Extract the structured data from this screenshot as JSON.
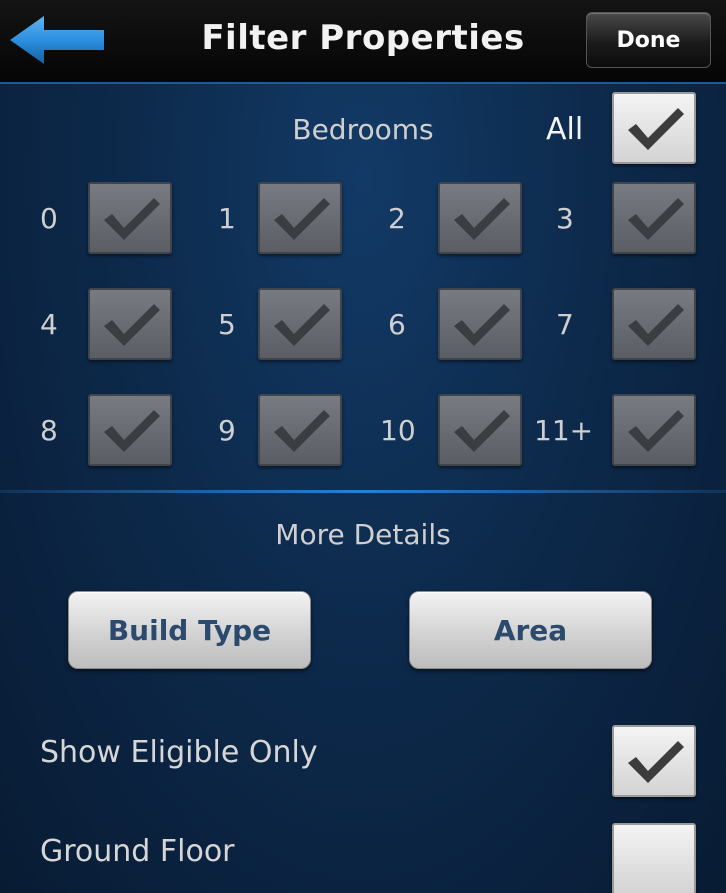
{
  "nav": {
    "title": "Filter Properties",
    "done_label": "Done",
    "back_icon": "back-arrow-icon"
  },
  "bedrooms": {
    "label": "Bedrooms",
    "all_label": "All",
    "all_checked": true,
    "options": [
      {
        "label": "0",
        "checked": true
      },
      {
        "label": "1",
        "checked": true
      },
      {
        "label": "2",
        "checked": true
      },
      {
        "label": "3",
        "checked": true
      },
      {
        "label": "4",
        "checked": true
      },
      {
        "label": "5",
        "checked": true
      },
      {
        "label": "6",
        "checked": true
      },
      {
        "label": "7",
        "checked": true
      },
      {
        "label": "8",
        "checked": true
      },
      {
        "label": "9",
        "checked": true
      },
      {
        "label": "10",
        "checked": true
      },
      {
        "label": "11+",
        "checked": true
      }
    ]
  },
  "more_details": {
    "label": "More Details",
    "build_type_label": "Build Type",
    "area_label": "Area"
  },
  "toggles": {
    "show_eligible_label": "Show Eligible Only",
    "show_eligible_checked": true,
    "ground_floor_label": "Ground Floor",
    "ground_floor_checked": false
  },
  "colors": {
    "accent": "#1e6fc0",
    "nav_background": "#0a0a0a",
    "page_background": "#0d2a4c"
  }
}
